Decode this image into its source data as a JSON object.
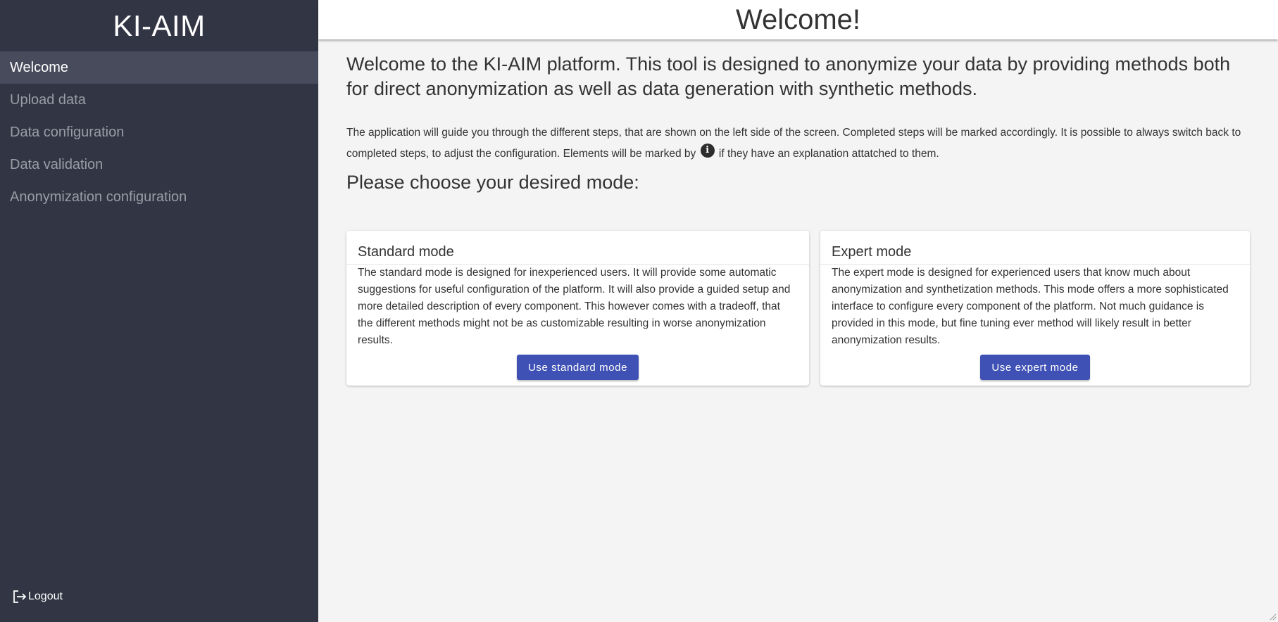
{
  "app": {
    "title": "KI-AIM"
  },
  "sidebar": {
    "items": [
      {
        "label": "Welcome",
        "active": true
      },
      {
        "label": "Upload data",
        "active": false
      },
      {
        "label": "Data configuration",
        "active": false
      },
      {
        "label": "Data validation",
        "active": false
      },
      {
        "label": "Anonymization configuration",
        "active": false
      }
    ],
    "logout_label": "Logout"
  },
  "header": {
    "title": "Welcome!"
  },
  "main": {
    "intro": "Welcome to the KI-AIM platform. This tool is designed to anonymize your data by providing methods both for direct anonymization as well as data generation with synthetic methods.",
    "description_part1": "The application will guide you through the different steps, that are shown on the left side of the screen. Completed steps will be marked accordingly. It is possible to always switch back to completed steps, to adjust the configuration. Elements will be marked by",
    "description_part2": "if they have an explanation attatched to them.",
    "mode_heading": "Please choose your desired mode:",
    "cards": [
      {
        "title": "Standard mode",
        "text": "The standard mode is designed for inexperienced users. It will provide some automatic suggestions for useful configuration of the platform. It will also provide a guided setup and more detailed description of every component. This however comes with a tradeoff, that the different methods might not be as customizable resulting in worse anonymization results.",
        "button_label": "Use standard mode"
      },
      {
        "title": "Expert mode",
        "text": "The expert mode is designed for experienced users that know much about anonymization and synthetization methods. This mode offers a more sophisticated interface to configure every component of the platform. Not much guidance is provided in this mode, but fine tuning ever method will likely result in better anonymization results.",
        "button_label": "Use expert mode"
      }
    ]
  },
  "colors": {
    "sidebar_bg": "#323544",
    "sidebar_active_bg": "#484b5b",
    "primary_button": "#3f51b5",
    "main_bg": "#f4f4f4"
  },
  "icons": {
    "info": "info-icon",
    "logout": "logout-icon"
  }
}
